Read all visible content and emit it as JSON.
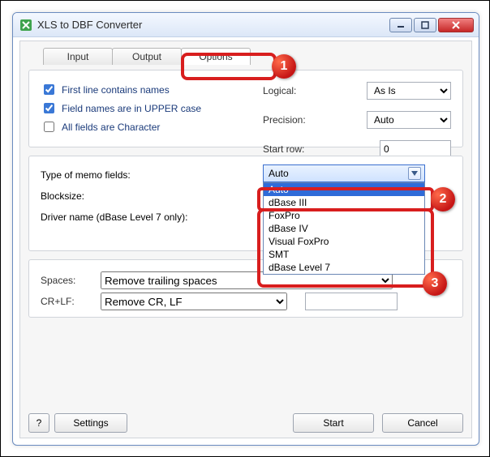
{
  "window": {
    "title": "XLS to DBF Converter"
  },
  "tabs": {
    "input": "Input",
    "output": "Output",
    "options": "Options"
  },
  "checks": {
    "first_line": "First line contains names",
    "upper": "Field names are in UPPER case",
    "allchar": "All fields are Character"
  },
  "labels": {
    "logical": "Logical:",
    "precision": "Precision:",
    "startrow": "Start row:",
    "memo_type": "Type of memo fields:",
    "blocksize": "Blocksize:",
    "driver": "Driver name (dBase Level 7 only):",
    "spaces": "Spaces:",
    "crlf": "CR+LF:"
  },
  "values": {
    "logical": "As Is",
    "precision": "Auto",
    "startrow": "0",
    "memo_selected": "Auto",
    "spaces": "Remove trailing spaces",
    "crlf": "Remove CR, LF"
  },
  "memo_options": [
    "Auto",
    "dBase III",
    "FoxPro",
    "dBase IV",
    "Visual FoxPro",
    "SMT",
    "dBase Level 7"
  ],
  "buttons": {
    "help": "?",
    "settings": "Settings",
    "start": "Start",
    "cancel": "Cancel"
  },
  "annotations": {
    "n1": "1",
    "n2": "2",
    "n3": "3"
  }
}
